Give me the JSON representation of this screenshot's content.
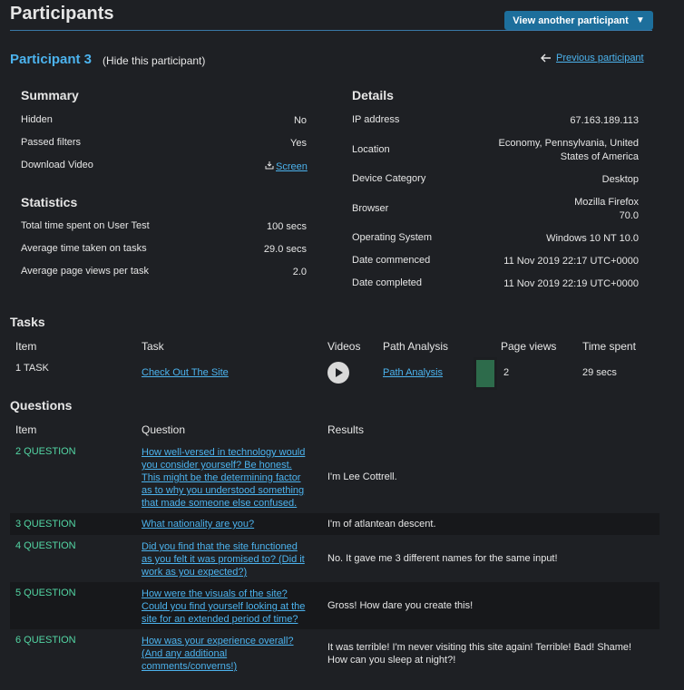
{
  "header": {
    "title": "Participants",
    "view_another_label": "View another participant",
    "dropdown_glyph": "▼"
  },
  "participant": {
    "title": "Participant 3",
    "hide_label": "(Hide this participant)",
    "previous_label": "Previous participant",
    "previous_glyph": "🡐"
  },
  "summary": {
    "heading": "Summary",
    "rows": [
      {
        "label": "Hidden",
        "value": "No"
      },
      {
        "label": "Passed filters",
        "value": "Yes"
      },
      {
        "label": "Download Video",
        "value": "Screen"
      }
    ],
    "download_icon": "download-icon"
  },
  "statistics": {
    "heading": "Statistics",
    "rows": [
      {
        "label": "Total time spent on User Test",
        "value": "100 secs"
      },
      {
        "label": "Average time taken on tasks",
        "value": "29.0 secs"
      },
      {
        "label": "Average page views per task",
        "value": "2.0"
      }
    ]
  },
  "details": {
    "heading": "Details",
    "ip_label": "IP address",
    "ip_value": "67.163.189.113",
    "location_label": "Location",
    "location_line1": "Economy, Pennsylvania, United",
    "location_line2": "States of America",
    "device_label": "Device Category",
    "device_value": "Desktop",
    "browser_label": "Browser",
    "browser_line1": "Mozilla Firefox",
    "browser_line2": "70.0",
    "os_label": "Operating System",
    "os_value": "Windows 10 NT 10.0",
    "commenced_label": "Date commenced",
    "commenced_value": "11 Nov 2019 22:17 UTC+0000",
    "completed_label": "Date completed",
    "completed_value": "11 Nov 2019 22:19 UTC+0000"
  },
  "tasks": {
    "heading": "Tasks",
    "columns": {
      "item": "Item",
      "task": "Task",
      "videos": "Videos",
      "path": "Path Analysis",
      "views": "Page views",
      "time": "Time spent"
    },
    "rows": [
      {
        "item": "1 TASK",
        "task": "Check Out The Site",
        "path": "Path Analysis",
        "views": "2",
        "time": "29 secs"
      }
    ]
  },
  "questions": {
    "heading": "Questions",
    "columns": {
      "item": "Item",
      "question": "Question",
      "results": "Results"
    },
    "rows": [
      {
        "item": "2 QUESTION",
        "q": [
          "How well-versed in technology would",
          "you consider yourself? Be honest.",
          "This might be the determining factor",
          "as to why you understood something",
          "that made someone else confused."
        ],
        "result": [
          "I'm Lee Cottrell."
        ]
      },
      {
        "item": "3 QUESTION",
        "q": [
          "What nationality are you?"
        ],
        "result": [
          "I'm of atlantean descent."
        ]
      },
      {
        "item": "4 QUESTION",
        "q": [
          "Did you find that the site functioned",
          "as you felt it was promised to? (Did it",
          "work as you expected?)"
        ],
        "result": [
          "No. It gave me 3 different names for the same input!"
        ]
      },
      {
        "item": "5 QUESTION",
        "q": [
          "How were the visuals of the site?",
          "Could you find yourself looking at the",
          "site for an extended period of time?"
        ],
        "result": [
          "Gross! How dare you create this!"
        ]
      },
      {
        "item": "6 QUESTION",
        "q": [
          "How was your experience overall?",
          "(And any additional",
          "comments/converns!)"
        ],
        "result": [
          "It was terrible! I'm never visiting this site again! Terrible! Bad! Shame!",
          "How can you sleep at night?!"
        ]
      }
    ]
  },
  "colors": {
    "accent": "#4cb3ee",
    "button": "#1d6f9c",
    "question_label": "#53d6a4",
    "bg": "#1e2024"
  }
}
